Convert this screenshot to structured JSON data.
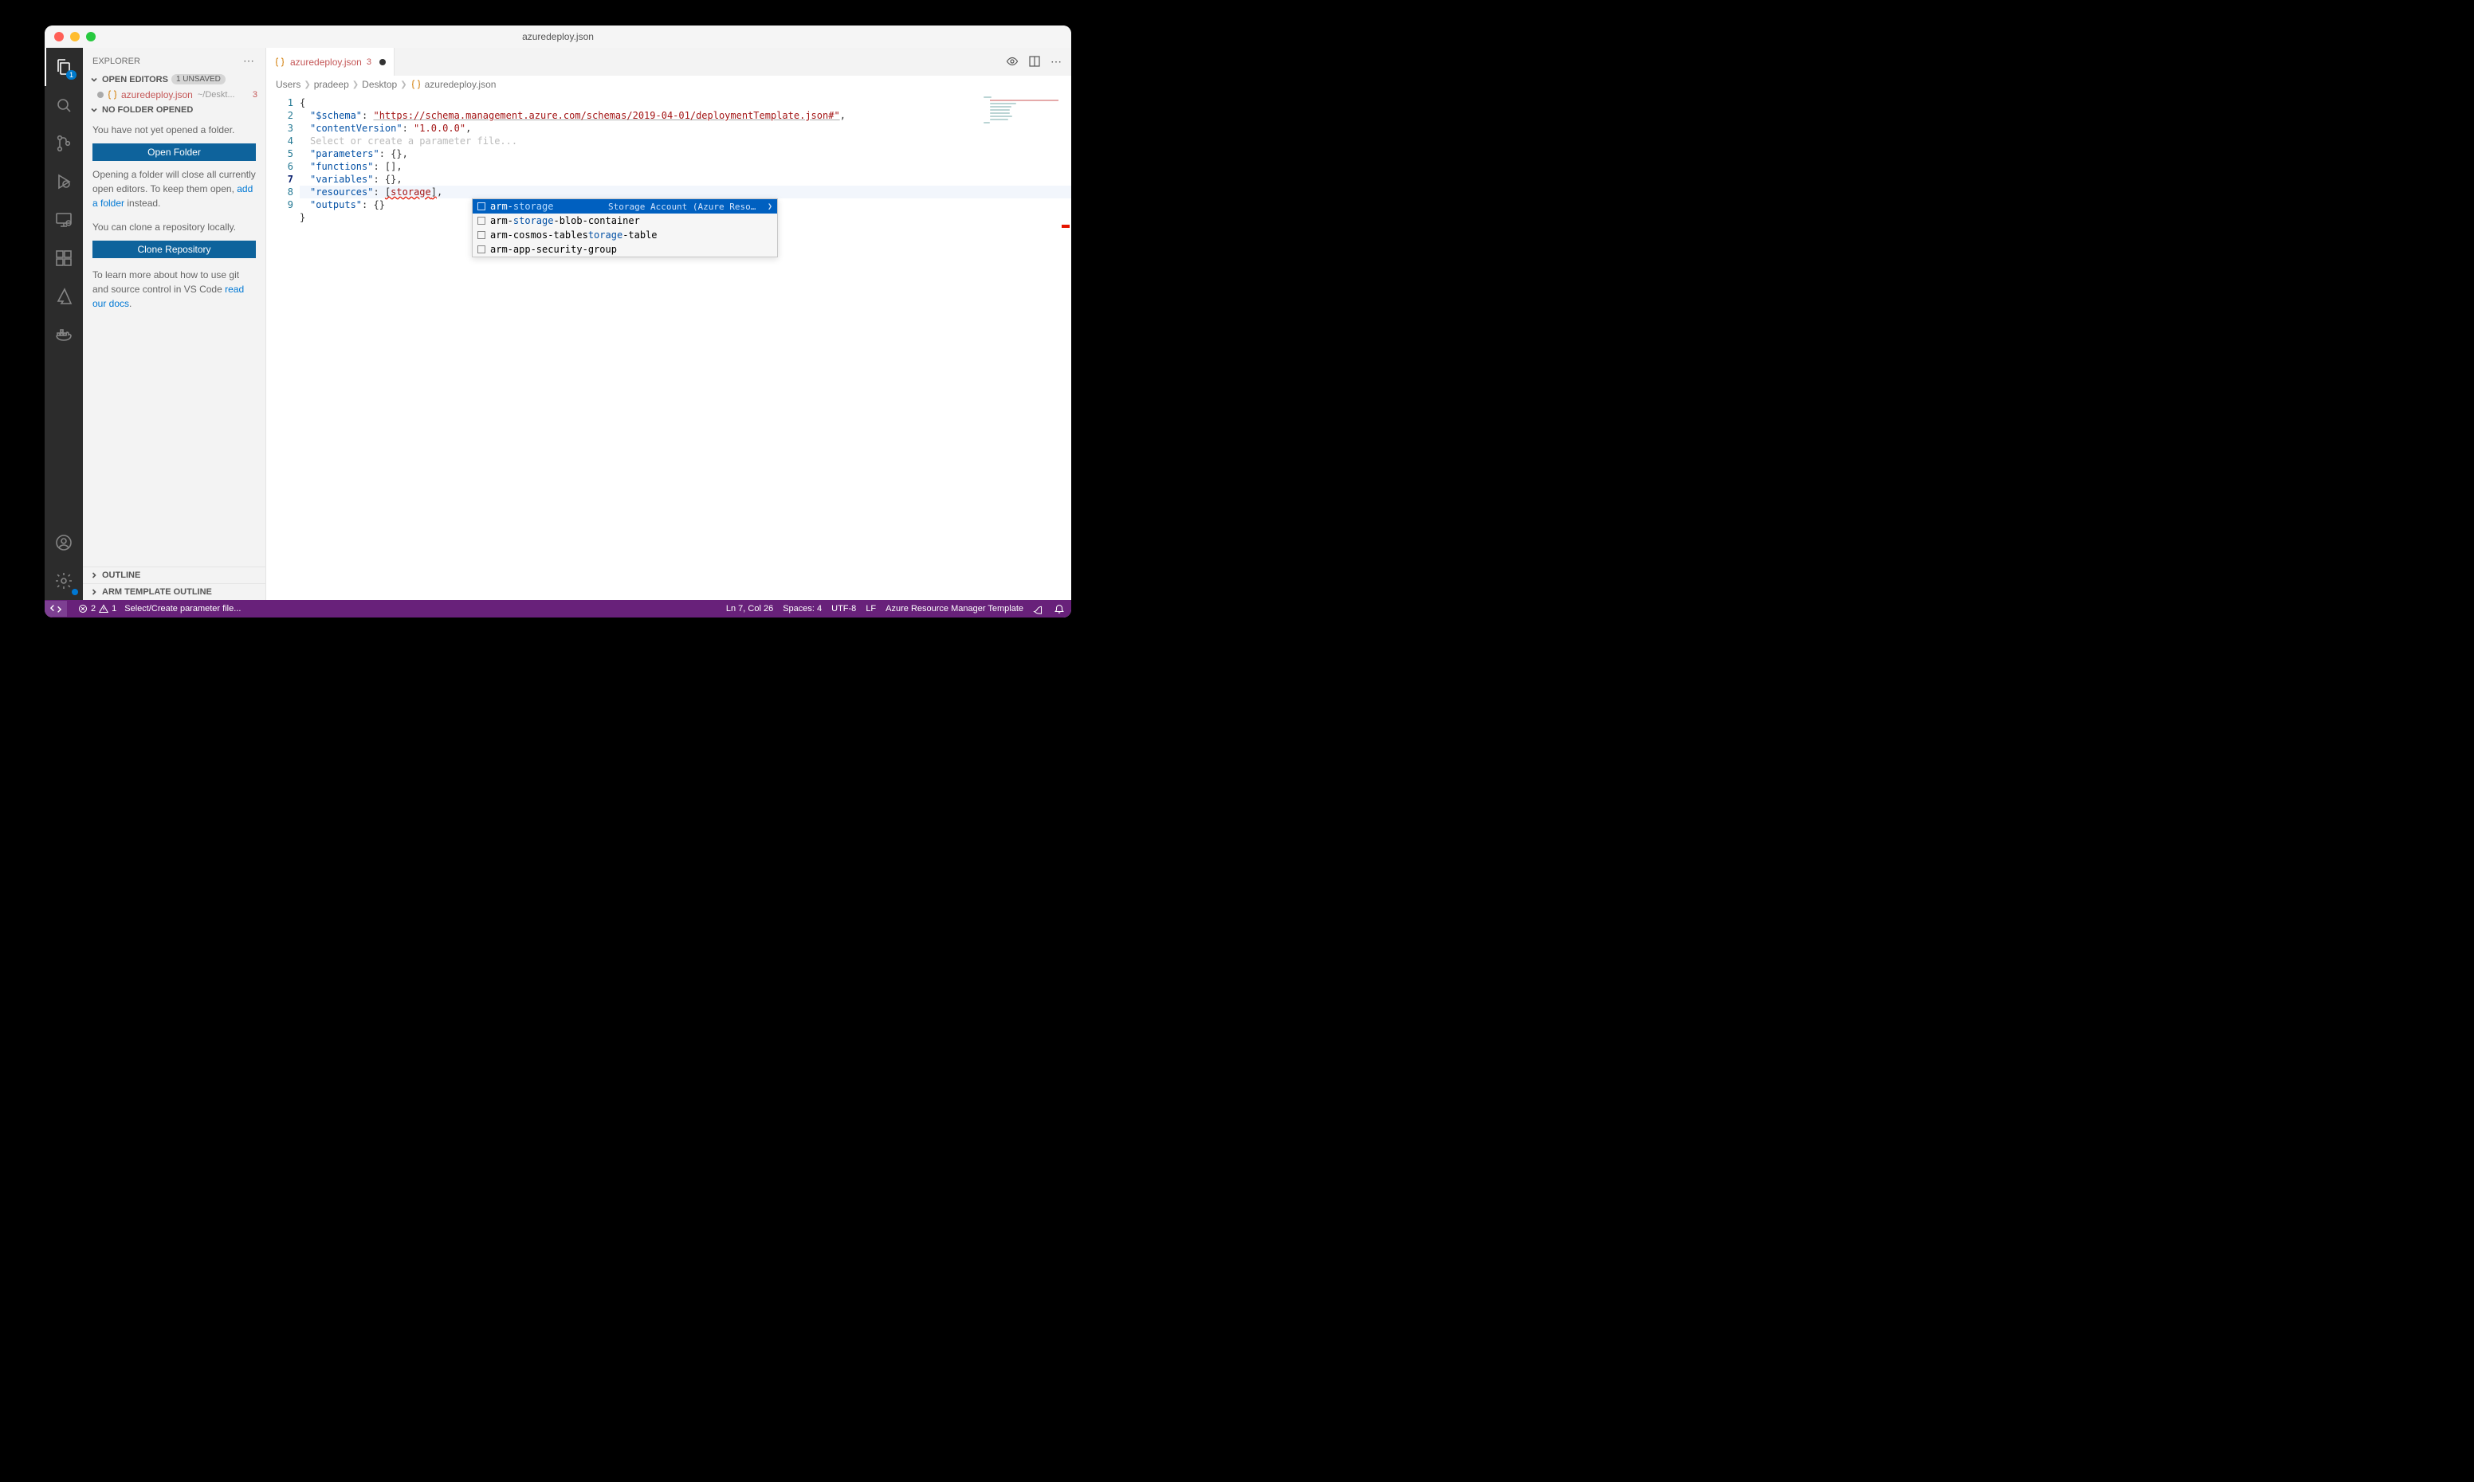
{
  "titlebar": {
    "title": "azuredeploy.json"
  },
  "activityBar": {
    "explorerBadge": "1"
  },
  "sidebar": {
    "title": "EXPLORER",
    "openEditors": {
      "label": "OPEN EDITORS",
      "unsaved": "1 UNSAVED"
    },
    "openFile": {
      "name": "azuredeploy.json",
      "path": "~/Deskt...",
      "problems": "3"
    },
    "noFolderHeader": "NO FOLDER OPENED",
    "noFolderText": "You have not yet opened a folder.",
    "openFolderBtn": "Open Folder",
    "closeText1": "Opening a folder will close all currently open editors. To keep them open, ",
    "addFolderLink": "add a folder",
    "closeText2": " instead.",
    "cloneText": "You can clone a repository locally.",
    "cloneBtn": "Clone Repository",
    "docsText1": "To learn more about how to use git and source control in VS Code ",
    "docsLink": "read our docs",
    "docsText2": ".",
    "outline": "OUTLINE",
    "armOutline": "ARM TEMPLATE OUTLINE"
  },
  "tabs": {
    "file": "azuredeploy.json",
    "problems": "3"
  },
  "breadcrumb": [
    "Users",
    "pradeep",
    "Desktop",
    "azuredeploy.json"
  ],
  "code": {
    "schemaKey": "\"$schema\"",
    "schemaVal": "\"https://schema.management.azure.com/schemas/2019-04-01/deploymentTemplate.json#\"",
    "contentKey": "\"contentVersion\"",
    "contentVal": "\"1.0.0.0\"",
    "hint": "Select or create a parameter file...",
    "paramsKey": "\"parameters\"",
    "funcKey": "\"functions\"",
    "varsKey": "\"variables\"",
    "resKey": "\"resources\"",
    "typed": "storage",
    "outKey": "\"outputs\""
  },
  "suggest": {
    "items": [
      {
        "pre": "arm-",
        "hl": "storage",
        "post": "",
        "desc": "Storage Account (Azure Resource Manager To…"
      },
      {
        "pre": "arm-",
        "hl": "storage",
        "post": "-blob-container"
      },
      {
        "pre": "arm-cosmos-table",
        "hl": "storage",
        "post": "-table",
        "altpre": "arm-cosmos-tables",
        "althl": "torage",
        "altpost": "-table"
      },
      {
        "pre": "arm-app-security-group",
        "hl": "",
        "post": ""
      }
    ]
  },
  "statusbar": {
    "errors": "2",
    "warnings": "1",
    "paramFile": "Select/Create parameter file...",
    "lncol": "Ln 7, Col 26",
    "spaces": "Spaces: 4",
    "encoding": "UTF-8",
    "eol": "LF",
    "lang": "Azure Resource Manager Template"
  }
}
